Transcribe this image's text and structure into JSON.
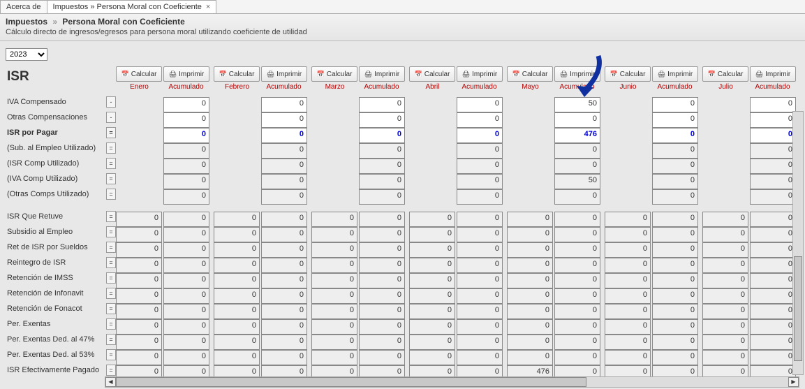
{
  "tabs": {
    "about": "Acerca de",
    "active": "Impuestos » Persona Moral con Coeficiente"
  },
  "title": {
    "bc1": "Impuestos",
    "bc2": "Persona Moral con Coeficiente",
    "desc": "Cálculo directo de ingresos/egresos para persona moral utilizando coeficiente de utilidad"
  },
  "year": "2023",
  "isr_heading": "ISR",
  "buttons": {
    "calcular": "Calcular",
    "imprimir": "Imprimir"
  },
  "col_headers": {
    "acumulado": "Acumulado"
  },
  "months": [
    {
      "name": "Enero"
    },
    {
      "name": "Febrero"
    },
    {
      "name": "Marzo"
    },
    {
      "name": "Abril"
    },
    {
      "name": "Mayo"
    },
    {
      "name": "Junio"
    },
    {
      "name": "Julio"
    }
  ],
  "row_meta": [
    {
      "label": "IVA Compensado",
      "eq": "-",
      "section": 0,
      "single": true,
      "editable": true,
      "blue": false
    },
    {
      "label": "Otras Compensaciones",
      "eq": "-",
      "section": 0,
      "single": true,
      "editable": true,
      "blue": false
    },
    {
      "label": "ISR por Pagar",
      "eq": "=",
      "section": 0,
      "single": true,
      "editable": true,
      "blue": true,
      "bold": true
    },
    {
      "label": "(Sub. al Empleo Utilizado)",
      "eq": "=",
      "section": 0,
      "single": true,
      "editable": false,
      "blue": false
    },
    {
      "label": "(ISR Comp Utilizado)",
      "eq": "=",
      "section": 0,
      "single": true,
      "editable": false,
      "blue": false
    },
    {
      "label": "(IVA Comp Utilizado)",
      "eq": "=",
      "section": 0,
      "single": true,
      "editable": false,
      "blue": false
    },
    {
      "label": "(Otras Comps Utilizado)",
      "eq": "=",
      "section": 0,
      "single": true,
      "editable": false,
      "blue": false
    },
    {
      "label": "ISR Que Retuve",
      "eq": "=",
      "section": 1,
      "single": false,
      "editable": false,
      "blue": false
    },
    {
      "label": "Subsidio al Empleo",
      "eq": "=",
      "section": 1,
      "single": false,
      "editable": false,
      "blue": false
    },
    {
      "label": "Ret de ISR por Sueldos",
      "eq": "=",
      "section": 1,
      "single": false,
      "editable": false,
      "blue": false
    },
    {
      "label": "Reintegro de ISR",
      "eq": "=",
      "section": 1,
      "single": false,
      "editable": false,
      "blue": false
    },
    {
      "label": "Retención de IMSS",
      "eq": "=",
      "section": 1,
      "single": false,
      "editable": false,
      "blue": false
    },
    {
      "label": "Retención de Infonavit",
      "eq": "=",
      "section": 1,
      "single": false,
      "editable": false,
      "blue": false
    },
    {
      "label": "Retención de Fonacot",
      "eq": "=",
      "section": 1,
      "single": false,
      "editable": false,
      "blue": false
    },
    {
      "label": "Per. Exentas",
      "eq": "=",
      "section": 1,
      "single": false,
      "editable": false,
      "blue": false
    },
    {
      "label": "Per. Exentas Ded. al 47%",
      "eq": "=",
      "section": 1,
      "single": false,
      "editable": false,
      "blue": false
    },
    {
      "label": "Per. Exentas Ded. al 53%",
      "eq": "=",
      "section": 1,
      "single": false,
      "editable": false,
      "blue": false
    },
    {
      "label": "ISR Efectivamente Pagado",
      "eq": "=",
      "section": 1,
      "single": false,
      "editable": false,
      "blue": false
    }
  ],
  "data": {
    "Enero": {
      "acum": [
        0,
        0,
        0,
        0,
        0,
        0,
        0
      ],
      "mes": [
        0,
        0,
        0,
        0,
        0,
        0,
        0,
        0,
        0,
        0,
        0
      ],
      "acum2": [
        0,
        0,
        0,
        0,
        0,
        0,
        0,
        0,
        0,
        0,
        0
      ]
    },
    "Febrero": {
      "acum": [
        0,
        0,
        0,
        0,
        0,
        0,
        0
      ],
      "mes": [
        0,
        0,
        0,
        0,
        0,
        0,
        0,
        0,
        0,
        0,
        0
      ],
      "acum2": [
        0,
        0,
        0,
        0,
        0,
        0,
        0,
        0,
        0,
        0,
        0
      ]
    },
    "Marzo": {
      "acum": [
        0,
        0,
        0,
        0,
        0,
        0,
        0
      ],
      "mes": [
        0,
        0,
        0,
        0,
        0,
        0,
        0,
        0,
        0,
        0,
        0
      ],
      "acum2": [
        0,
        0,
        0,
        0,
        0,
        0,
        0,
        0,
        0,
        0,
        0
      ]
    },
    "Abril": {
      "acum": [
        0,
        0,
        0,
        0,
        0,
        0,
        0
      ],
      "mes": [
        0,
        0,
        0,
        0,
        0,
        0,
        0,
        0,
        0,
        0,
        0
      ],
      "acum2": [
        0,
        0,
        0,
        0,
        0,
        0,
        0,
        0,
        0,
        0,
        0
      ]
    },
    "Mayo": {
      "acum": [
        50,
        0,
        476,
        0,
        0,
        50,
        0
      ],
      "mes": [
        0,
        0,
        0,
        0,
        0,
        0,
        0,
        0,
        0,
        0,
        476
      ],
      "acum2": [
        0,
        0,
        0,
        0,
        0,
        0,
        0,
        0,
        0,
        0,
        0
      ]
    },
    "Junio": {
      "acum": [
        0,
        0,
        0,
        0,
        0,
        0,
        0
      ],
      "mes": [
        0,
        0,
        0,
        0,
        0,
        0,
        0,
        0,
        0,
        0,
        0
      ],
      "acum2": [
        0,
        0,
        0,
        0,
        0,
        0,
        0,
        0,
        0,
        0,
        0
      ]
    },
    "Julio": {
      "acum": [
        0,
        0,
        0,
        0,
        0,
        0,
        0
      ],
      "mes": [
        0,
        0,
        0,
        0,
        0,
        0,
        0,
        0,
        0,
        0,
        0
      ],
      "acum2": [
        0,
        0,
        0,
        0,
        0,
        0,
        0,
        0,
        0,
        0,
        0
      ]
    }
  }
}
